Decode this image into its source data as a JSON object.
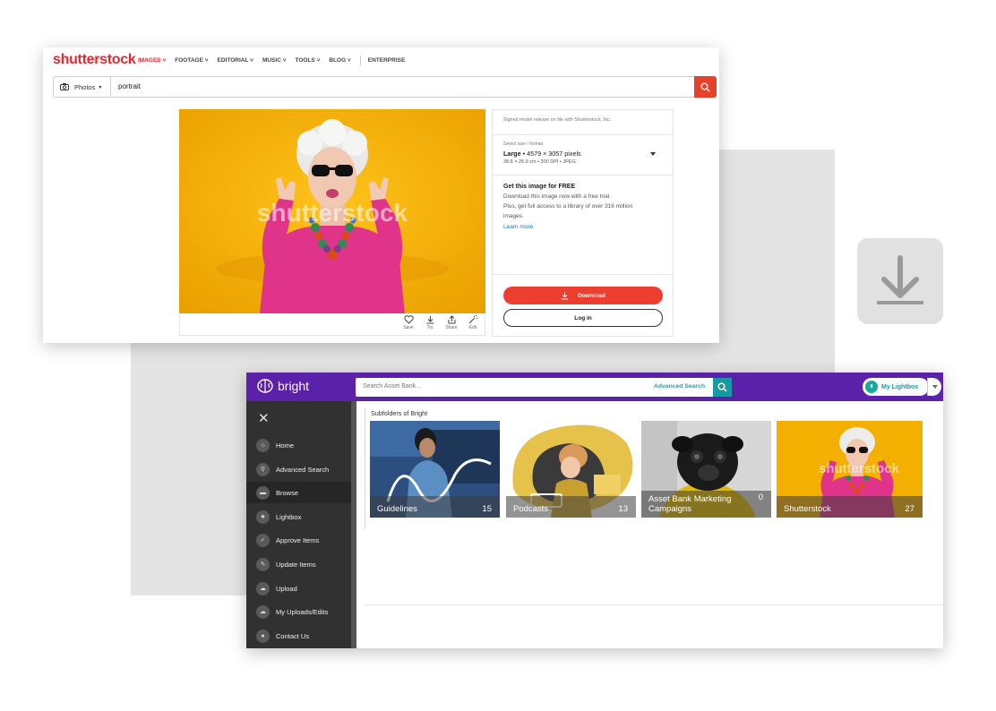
{
  "shutterstock": {
    "logo": "shutterstock",
    "nav": [
      "IMAGES",
      "FOOTAGE",
      "EDITORIAL",
      "MUSIC",
      "TOOLS",
      "BLOG"
    ],
    "enterprise": "ENTERPRISE",
    "search": {
      "type": "Photos",
      "query": "portrait"
    },
    "watermark": "shutterstock",
    "actions": [
      "Save",
      "Try",
      "Share",
      "Edit"
    ],
    "release": "Signed model release on file with Shutterstock, Inc.",
    "size_label": "Select size / format",
    "size_name": "Large",
    "size_pixels": "• 4579 × 3057 pixels",
    "size_details": "38.8 × 25.9 cm • 300 DPI • JPEG",
    "get_title": "Get this image for FREE",
    "get_lines": [
      "Download this image now with a free trial.",
      "Plus, get full access to a library of over 316 million",
      "images."
    ],
    "learn_more": "Learn more",
    "download": "Download",
    "login": "Log in"
  },
  "assetbank": {
    "logo": "bright",
    "search_placeholder": "Search Asset Bank...",
    "advanced": "Advanced Search",
    "lightbox_count": "8",
    "lightbox_label": "My Lightbox",
    "sidebar": [
      "Home",
      "Advanced Search",
      "Browse",
      "Lightbox",
      "Approve Items",
      "Update Items",
      "Upload",
      "My Uploads/Edits",
      "Contact Us"
    ],
    "active_item": "Browse",
    "subfolders_title": "Subfolders of Bright",
    "folders": [
      {
        "name": "Guidelines",
        "count": "15"
      },
      {
        "name": "Podcasts",
        "count": "13"
      },
      {
        "name": "Asset Bank Marketing Campaigns",
        "count": "0"
      },
      {
        "name": "Shutterstock",
        "count": "27"
      }
    ]
  },
  "colors": {
    "shutterstock_red": "#e8262b",
    "bright_purple": "#5b21a8",
    "teal": "#189aa6"
  }
}
